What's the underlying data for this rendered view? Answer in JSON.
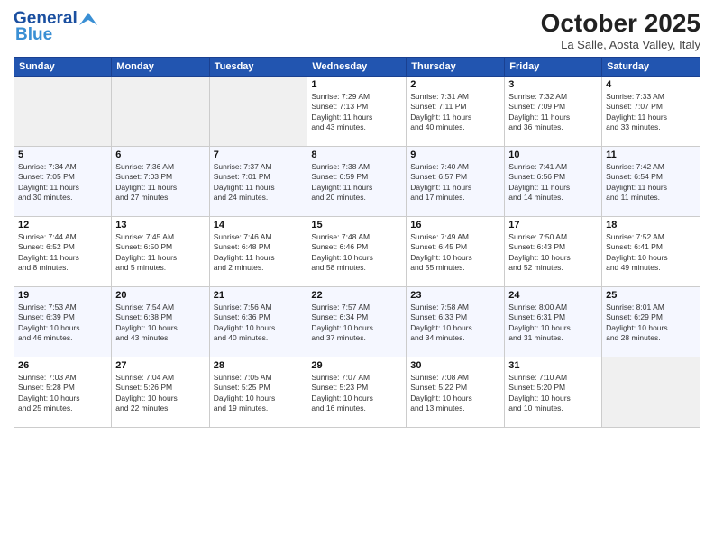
{
  "header": {
    "logo_general": "General",
    "logo_blue": "Blue",
    "month_title": "October 2025",
    "location": "La Salle, Aosta Valley, Italy"
  },
  "days_of_week": [
    "Sunday",
    "Monday",
    "Tuesday",
    "Wednesday",
    "Thursday",
    "Friday",
    "Saturday"
  ],
  "weeks": [
    [
      {
        "day": "",
        "info": ""
      },
      {
        "day": "",
        "info": ""
      },
      {
        "day": "",
        "info": ""
      },
      {
        "day": "1",
        "info": "Sunrise: 7:29 AM\nSunset: 7:13 PM\nDaylight: 11 hours\nand 43 minutes."
      },
      {
        "day": "2",
        "info": "Sunrise: 7:31 AM\nSunset: 7:11 PM\nDaylight: 11 hours\nand 40 minutes."
      },
      {
        "day": "3",
        "info": "Sunrise: 7:32 AM\nSunset: 7:09 PM\nDaylight: 11 hours\nand 36 minutes."
      },
      {
        "day": "4",
        "info": "Sunrise: 7:33 AM\nSunset: 7:07 PM\nDaylight: 11 hours\nand 33 minutes."
      }
    ],
    [
      {
        "day": "5",
        "info": "Sunrise: 7:34 AM\nSunset: 7:05 PM\nDaylight: 11 hours\nand 30 minutes."
      },
      {
        "day": "6",
        "info": "Sunrise: 7:36 AM\nSunset: 7:03 PM\nDaylight: 11 hours\nand 27 minutes."
      },
      {
        "day": "7",
        "info": "Sunrise: 7:37 AM\nSunset: 7:01 PM\nDaylight: 11 hours\nand 24 minutes."
      },
      {
        "day": "8",
        "info": "Sunrise: 7:38 AM\nSunset: 6:59 PM\nDaylight: 11 hours\nand 20 minutes."
      },
      {
        "day": "9",
        "info": "Sunrise: 7:40 AM\nSunset: 6:57 PM\nDaylight: 11 hours\nand 17 minutes."
      },
      {
        "day": "10",
        "info": "Sunrise: 7:41 AM\nSunset: 6:56 PM\nDaylight: 11 hours\nand 14 minutes."
      },
      {
        "day": "11",
        "info": "Sunrise: 7:42 AM\nSunset: 6:54 PM\nDaylight: 11 hours\nand 11 minutes."
      }
    ],
    [
      {
        "day": "12",
        "info": "Sunrise: 7:44 AM\nSunset: 6:52 PM\nDaylight: 11 hours\nand 8 minutes."
      },
      {
        "day": "13",
        "info": "Sunrise: 7:45 AM\nSunset: 6:50 PM\nDaylight: 11 hours\nand 5 minutes."
      },
      {
        "day": "14",
        "info": "Sunrise: 7:46 AM\nSunset: 6:48 PM\nDaylight: 11 hours\nand 2 minutes."
      },
      {
        "day": "15",
        "info": "Sunrise: 7:48 AM\nSunset: 6:46 PM\nDaylight: 10 hours\nand 58 minutes."
      },
      {
        "day": "16",
        "info": "Sunrise: 7:49 AM\nSunset: 6:45 PM\nDaylight: 10 hours\nand 55 minutes."
      },
      {
        "day": "17",
        "info": "Sunrise: 7:50 AM\nSunset: 6:43 PM\nDaylight: 10 hours\nand 52 minutes."
      },
      {
        "day": "18",
        "info": "Sunrise: 7:52 AM\nSunset: 6:41 PM\nDaylight: 10 hours\nand 49 minutes."
      }
    ],
    [
      {
        "day": "19",
        "info": "Sunrise: 7:53 AM\nSunset: 6:39 PM\nDaylight: 10 hours\nand 46 minutes."
      },
      {
        "day": "20",
        "info": "Sunrise: 7:54 AM\nSunset: 6:38 PM\nDaylight: 10 hours\nand 43 minutes."
      },
      {
        "day": "21",
        "info": "Sunrise: 7:56 AM\nSunset: 6:36 PM\nDaylight: 10 hours\nand 40 minutes."
      },
      {
        "day": "22",
        "info": "Sunrise: 7:57 AM\nSunset: 6:34 PM\nDaylight: 10 hours\nand 37 minutes."
      },
      {
        "day": "23",
        "info": "Sunrise: 7:58 AM\nSunset: 6:33 PM\nDaylight: 10 hours\nand 34 minutes."
      },
      {
        "day": "24",
        "info": "Sunrise: 8:00 AM\nSunset: 6:31 PM\nDaylight: 10 hours\nand 31 minutes."
      },
      {
        "day": "25",
        "info": "Sunrise: 8:01 AM\nSunset: 6:29 PM\nDaylight: 10 hours\nand 28 minutes."
      }
    ],
    [
      {
        "day": "26",
        "info": "Sunrise: 7:03 AM\nSunset: 5:28 PM\nDaylight: 10 hours\nand 25 minutes."
      },
      {
        "day": "27",
        "info": "Sunrise: 7:04 AM\nSunset: 5:26 PM\nDaylight: 10 hours\nand 22 minutes."
      },
      {
        "day": "28",
        "info": "Sunrise: 7:05 AM\nSunset: 5:25 PM\nDaylight: 10 hours\nand 19 minutes."
      },
      {
        "day": "29",
        "info": "Sunrise: 7:07 AM\nSunset: 5:23 PM\nDaylight: 10 hours\nand 16 minutes."
      },
      {
        "day": "30",
        "info": "Sunrise: 7:08 AM\nSunset: 5:22 PM\nDaylight: 10 hours\nand 13 minutes."
      },
      {
        "day": "31",
        "info": "Sunrise: 7:10 AM\nSunset: 5:20 PM\nDaylight: 10 hours\nand 10 minutes."
      },
      {
        "day": "",
        "info": ""
      }
    ]
  ]
}
